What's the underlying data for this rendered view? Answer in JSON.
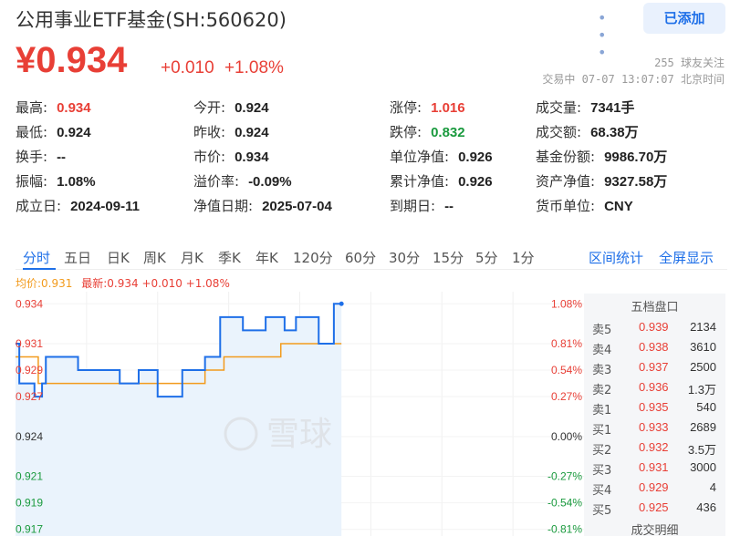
{
  "header": {
    "title": "公用事业ETF基金(SH:560620)",
    "more_icon": "more-dots-icon",
    "add_button": "已添加"
  },
  "quote": {
    "price": "¥0.934",
    "change": "+0.010",
    "change_pct": "+1.08%",
    "followers": "255 球友关注",
    "status_time": "交易中 07-07 13:07:07 北京时间"
  },
  "stats": [
    [
      {
        "k": "最高:",
        "v": "0.934",
        "color": "red"
      },
      {
        "k": "今开:",
        "v": "0.924"
      },
      {
        "k": "涨停:",
        "v": "1.016",
        "color": "red"
      },
      {
        "k": "成交量:",
        "v": "7341手"
      }
    ],
    [
      {
        "k": "最低:",
        "v": "0.924"
      },
      {
        "k": "昨收:",
        "v": "0.924"
      },
      {
        "k": "跌停:",
        "v": "0.832",
        "color": "green"
      },
      {
        "k": "成交额:",
        "v": "68.38万"
      }
    ],
    [
      {
        "k": "换手:",
        "v": "--"
      },
      {
        "k": "市价:",
        "v": "0.934"
      },
      {
        "k": "单位净值:",
        "v": "0.926"
      },
      {
        "k": "基金份额:",
        "v": "9986.70万"
      }
    ],
    [
      {
        "k": "振幅:",
        "v": "1.08%"
      },
      {
        "k": "溢价率:",
        "v": "-0.09%"
      },
      {
        "k": "累计净值:",
        "v": "0.926"
      },
      {
        "k": "资产净值:",
        "v": "9327.58万"
      }
    ],
    [
      {
        "k": "成立日:",
        "v": "2024-09-11"
      },
      {
        "k": "净值日期:",
        "v": "2025-07-04"
      },
      {
        "k": "到期日:",
        "v": "--"
      },
      {
        "k": "货币单位:",
        "v": "CNY"
      }
    ]
  ],
  "tabs": [
    "分时",
    "五日",
    "日K",
    "周K",
    "月K",
    "季K",
    "年K",
    "120分",
    "60分",
    "30分",
    "15分",
    "5分",
    "1分"
  ],
  "tab_right": [
    "区间统计",
    "全屏显示"
  ],
  "legend": {
    "avg": "均价:0.931",
    "latest": "最新:0.934 +0.010 +1.08%"
  },
  "chart_data": {
    "type": "line",
    "y_left_ticks": [
      {
        "v": "0.934",
        "color": "red"
      },
      {
        "v": "0.931",
        "color": "red"
      },
      {
        "v": "0.929",
        "color": "red"
      },
      {
        "v": "0.927",
        "color": "red"
      },
      {
        "v": "0.924",
        "color": "dark"
      },
      {
        "v": "0.921",
        "color": "green"
      },
      {
        "v": "0.919",
        "color": "green"
      },
      {
        "v": "0.917",
        "color": "green"
      }
    ],
    "y_right_ticks": [
      {
        "v": "1.08%",
        "color": "red"
      },
      {
        "v": "0.81%",
        "color": "red"
      },
      {
        "v": "0.54%",
        "color": "red"
      },
      {
        "v": "0.27%",
        "color": "red"
      },
      {
        "v": "0.00%",
        "color": "dark"
      },
      {
        "v": "-0.27%",
        "color": "green"
      },
      {
        "v": "-0.54%",
        "color": "green"
      },
      {
        "v": "-0.81%",
        "color": "green"
      }
    ],
    "ylim": [
      0.9165,
      0.9345
    ],
    "watermark": "雪球",
    "price_series": [
      [
        0,
        0.931
      ],
      [
        2,
        0.931
      ],
      [
        2,
        0.928
      ],
      [
        10,
        0.928
      ],
      [
        10,
        0.927
      ],
      [
        14,
        0.927
      ],
      [
        14,
        0.928
      ],
      [
        16,
        0.928
      ],
      [
        16,
        0.93
      ],
      [
        33,
        0.93
      ],
      [
        33,
        0.929
      ],
      [
        55,
        0.929
      ],
      [
        55,
        0.928
      ],
      [
        65,
        0.928
      ],
      [
        65,
        0.929
      ],
      [
        75,
        0.929
      ],
      [
        75,
        0.927
      ],
      [
        88,
        0.927
      ],
      [
        88,
        0.929
      ],
      [
        100,
        0.929
      ],
      [
        100,
        0.93
      ],
      [
        108,
        0.93
      ],
      [
        108,
        0.933
      ],
      [
        120,
        0.933
      ],
      [
        120,
        0.932
      ],
      [
        132,
        0.932
      ],
      [
        132,
        0.933
      ],
      [
        142,
        0.933
      ],
      [
        142,
        0.932
      ],
      [
        148,
        0.932
      ],
      [
        148,
        0.933
      ],
      [
        160,
        0.933
      ],
      [
        160,
        0.931
      ],
      [
        168,
        0.931
      ],
      [
        168,
        0.934
      ],
      [
        172,
        0.934
      ]
    ],
    "avg_series": [
      [
        0,
        0.93
      ],
      [
        12,
        0.93
      ],
      [
        12,
        0.928
      ],
      [
        35,
        0.928
      ],
      [
        35,
        0.928
      ],
      [
        100,
        0.928
      ],
      [
        100,
        0.929
      ],
      [
        110,
        0.929
      ],
      [
        110,
        0.93
      ],
      [
        140,
        0.93
      ],
      [
        140,
        0.931
      ],
      [
        172,
        0.931
      ]
    ],
    "x_max": 300
  },
  "order_book": {
    "title": "五档盘口",
    "rows": [
      {
        "lbl": "卖5",
        "p": "0.939",
        "q": "2134"
      },
      {
        "lbl": "卖4",
        "p": "0.938",
        "q": "3610"
      },
      {
        "lbl": "卖3",
        "p": "0.937",
        "q": "2500"
      },
      {
        "lbl": "卖2",
        "p": "0.936",
        "q": "1.3万"
      },
      {
        "lbl": "卖1",
        "p": "0.935",
        "q": "540"
      },
      {
        "lbl": "买1",
        "p": "0.933",
        "q": "2689"
      },
      {
        "lbl": "买2",
        "p": "0.932",
        "q": "3.5万"
      },
      {
        "lbl": "买3",
        "p": "0.931",
        "q": "3000"
      },
      {
        "lbl": "买4",
        "p": "0.929",
        "q": "4"
      },
      {
        "lbl": "买5",
        "p": "0.925",
        "q": "436"
      }
    ],
    "trade_title": "成交明细"
  },
  "colors": {
    "red": "#e83f36",
    "green": "#1a9a3e",
    "blue": "#1e6fe8",
    "orange": "#f29b1d"
  }
}
